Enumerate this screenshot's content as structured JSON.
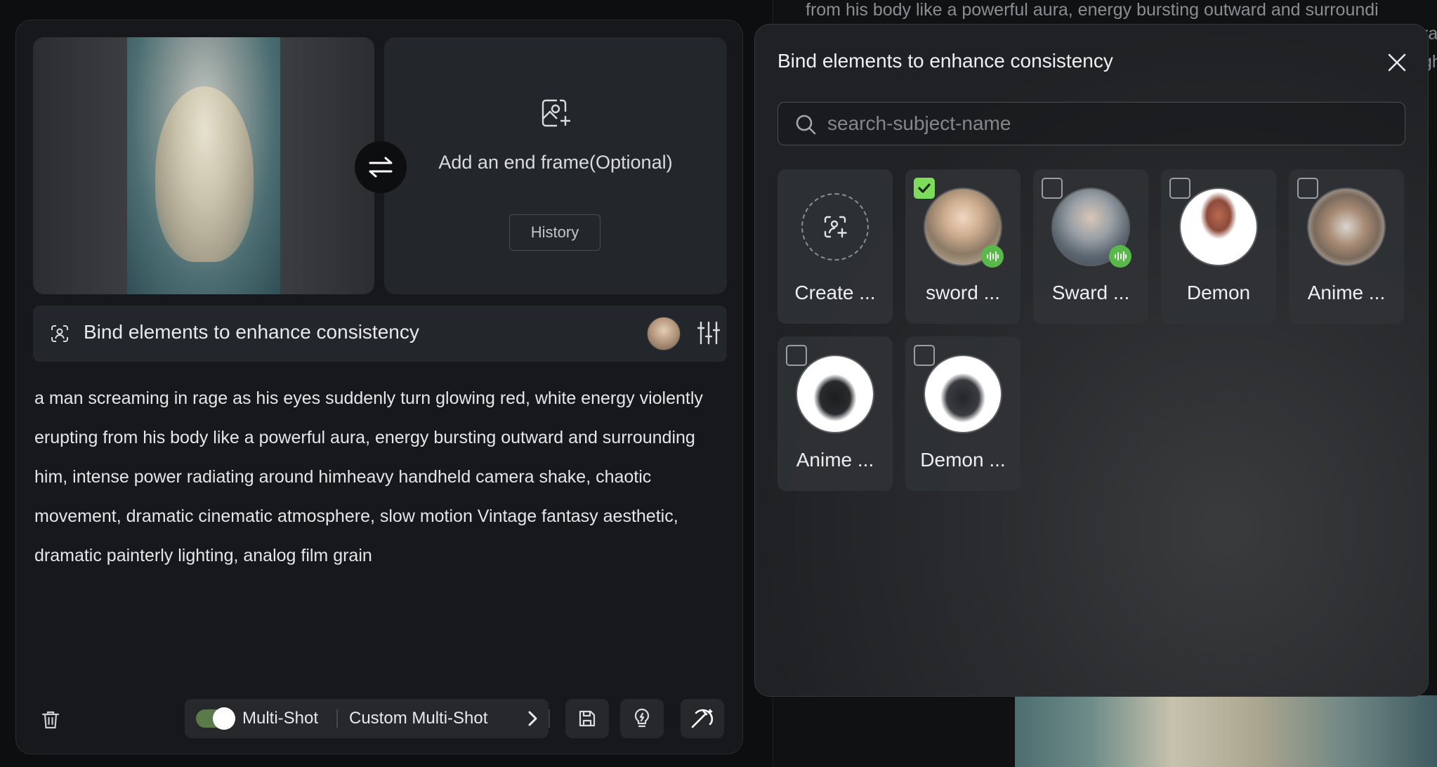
{
  "background": {
    "prompt_line1": "from his body like a powerful aura, energy bursting outward and surroundi",
    "prompt_line2": "ra",
    "prompt_line3": "gh"
  },
  "frames": {
    "end_frame_text": "Add an end frame(Optional)",
    "history_label": "History"
  },
  "bind_bar": {
    "label": "Bind elements to enhance consistency"
  },
  "prompt": {
    "text": "a man screaming in rage as his eyes suddenly turn glowing red, white energy violently erupting from his body like a powerful aura, energy bursting outward and surrounding him, intense power radiating around himheavy handheld camera shake, chaotic movement, dramatic cinematic atmosphere, slow motion Vintage fantasy aesthetic, dramatic painterly lighting, analog film grain"
  },
  "bottom_bar": {
    "multishot_label": "Multi-Shot",
    "multishot_on": true,
    "custom_label": "Custom Multi-Shot"
  },
  "popup": {
    "title": "Bind elements to enhance consistency",
    "search_placeholder": "search-subject-name",
    "items": [
      {
        "label": "Create ...",
        "kind": "create",
        "checked": false
      },
      {
        "label": "sword ...",
        "kind": "subject",
        "checked": true,
        "voice": true
      },
      {
        "label": "Sward ...",
        "kind": "subject",
        "checked": false,
        "voice": true
      },
      {
        "label": "Demon",
        "kind": "subject",
        "checked": false,
        "voice": false
      },
      {
        "label": "Anime ...",
        "kind": "subject",
        "checked": false,
        "voice": false
      },
      {
        "label": "Anime ...",
        "kind": "subject",
        "checked": false,
        "voice": false
      },
      {
        "label": "Demon ...",
        "kind": "subject",
        "checked": false,
        "voice": false
      }
    ]
  },
  "colors": {
    "accent_green": "#7ddc5c",
    "voice_badge": "#58b94a",
    "toggle_on": "#5a7a4a"
  }
}
